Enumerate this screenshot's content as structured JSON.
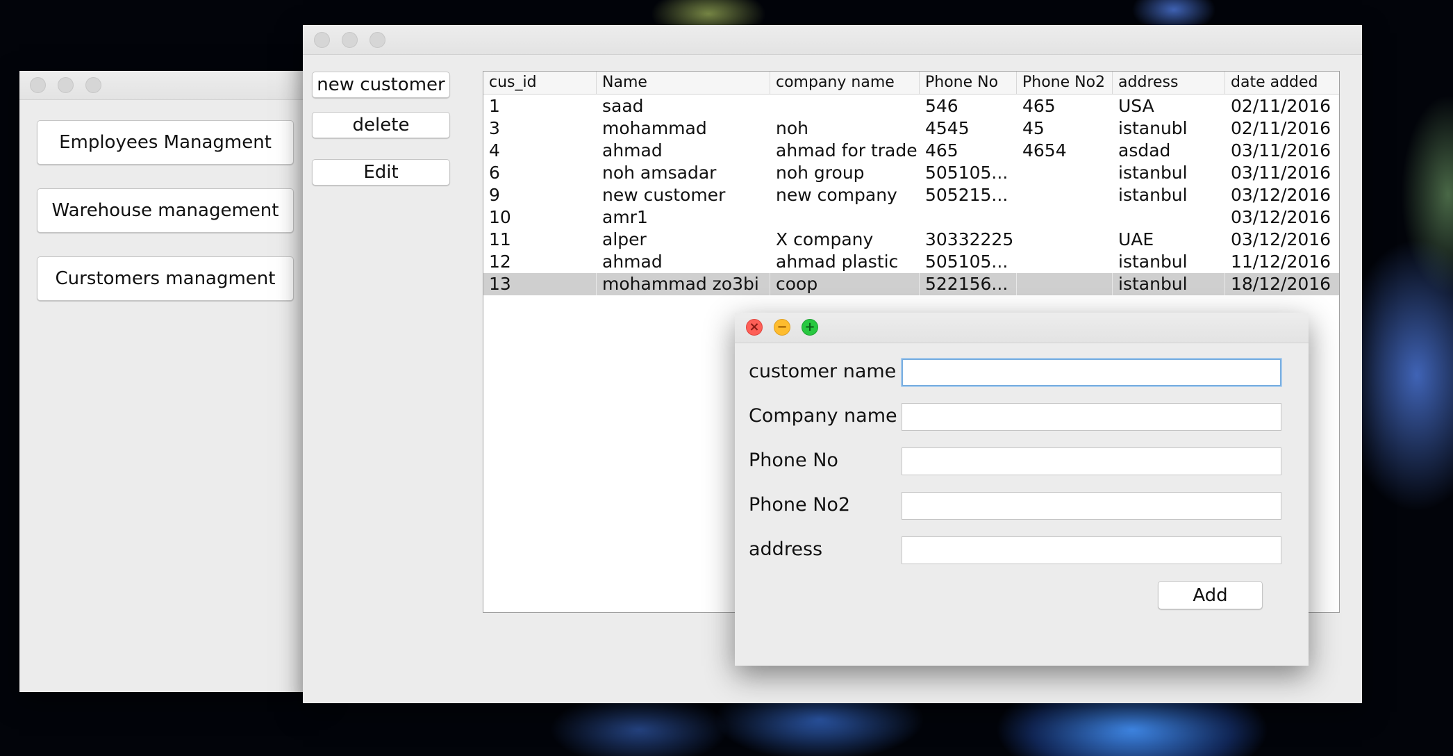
{
  "main_menu": {
    "buttons": [
      "Employees Managment",
      "Warehouse management",
      "Curstomers managment"
    ]
  },
  "customers_window": {
    "buttons": {
      "new_customer": "new customer",
      "delete": "delete",
      "edit": "Edit"
    },
    "table": {
      "columns": [
        "cus_id",
        "Name",
        "company name",
        "Phone No",
        "Phone No2",
        "address",
        "date added"
      ],
      "rows": [
        [
          "1",
          "saad",
          "",
          "546",
          "465",
          "USA",
          "02/11/2016"
        ],
        [
          "3",
          "mohammad",
          "noh",
          "4545",
          "45",
          "istanubl",
          "02/11/2016"
        ],
        [
          "4",
          "ahmad",
          "ahmad for trade",
          "465",
          "4654",
          "asdad",
          "03/11/2016"
        ],
        [
          "6",
          "noh amsadar",
          "noh group",
          "505105...",
          "",
          "istanbul",
          "03/11/2016"
        ],
        [
          "9",
          "new customer",
          "new company",
          "505215...",
          "",
          "istanbul",
          "03/12/2016"
        ],
        [
          "10",
          "amr1",
          "",
          "",
          "",
          "",
          "03/12/2016"
        ],
        [
          "11",
          "alper",
          "X company",
          "30332225",
          "",
          "UAE",
          "03/12/2016"
        ],
        [
          "12",
          "ahmad",
          "ahmad plastic",
          "505105...",
          "",
          "istanbul",
          "11/12/2016"
        ],
        [
          "13",
          "mohammad zo3bi",
          "coop",
          "522156...",
          "",
          "istanbul",
          "18/12/2016"
        ]
      ],
      "selected_row": 8
    }
  },
  "add_dialog": {
    "fields": [
      {
        "label": "customer name",
        "value": ""
      },
      {
        "label": "Company name",
        "value": ""
      },
      {
        "label": "Phone No",
        "value": ""
      },
      {
        "label": "Phone No2",
        "value": ""
      },
      {
        "label": "address",
        "value": ""
      }
    ],
    "add_button": "Add",
    "colors": {
      "close": "#fe5f57",
      "minimize": "#febc2e",
      "zoom": "#28c840",
      "focus_ring": "#79aee0",
      "selection": "#cfcfcf"
    }
  }
}
